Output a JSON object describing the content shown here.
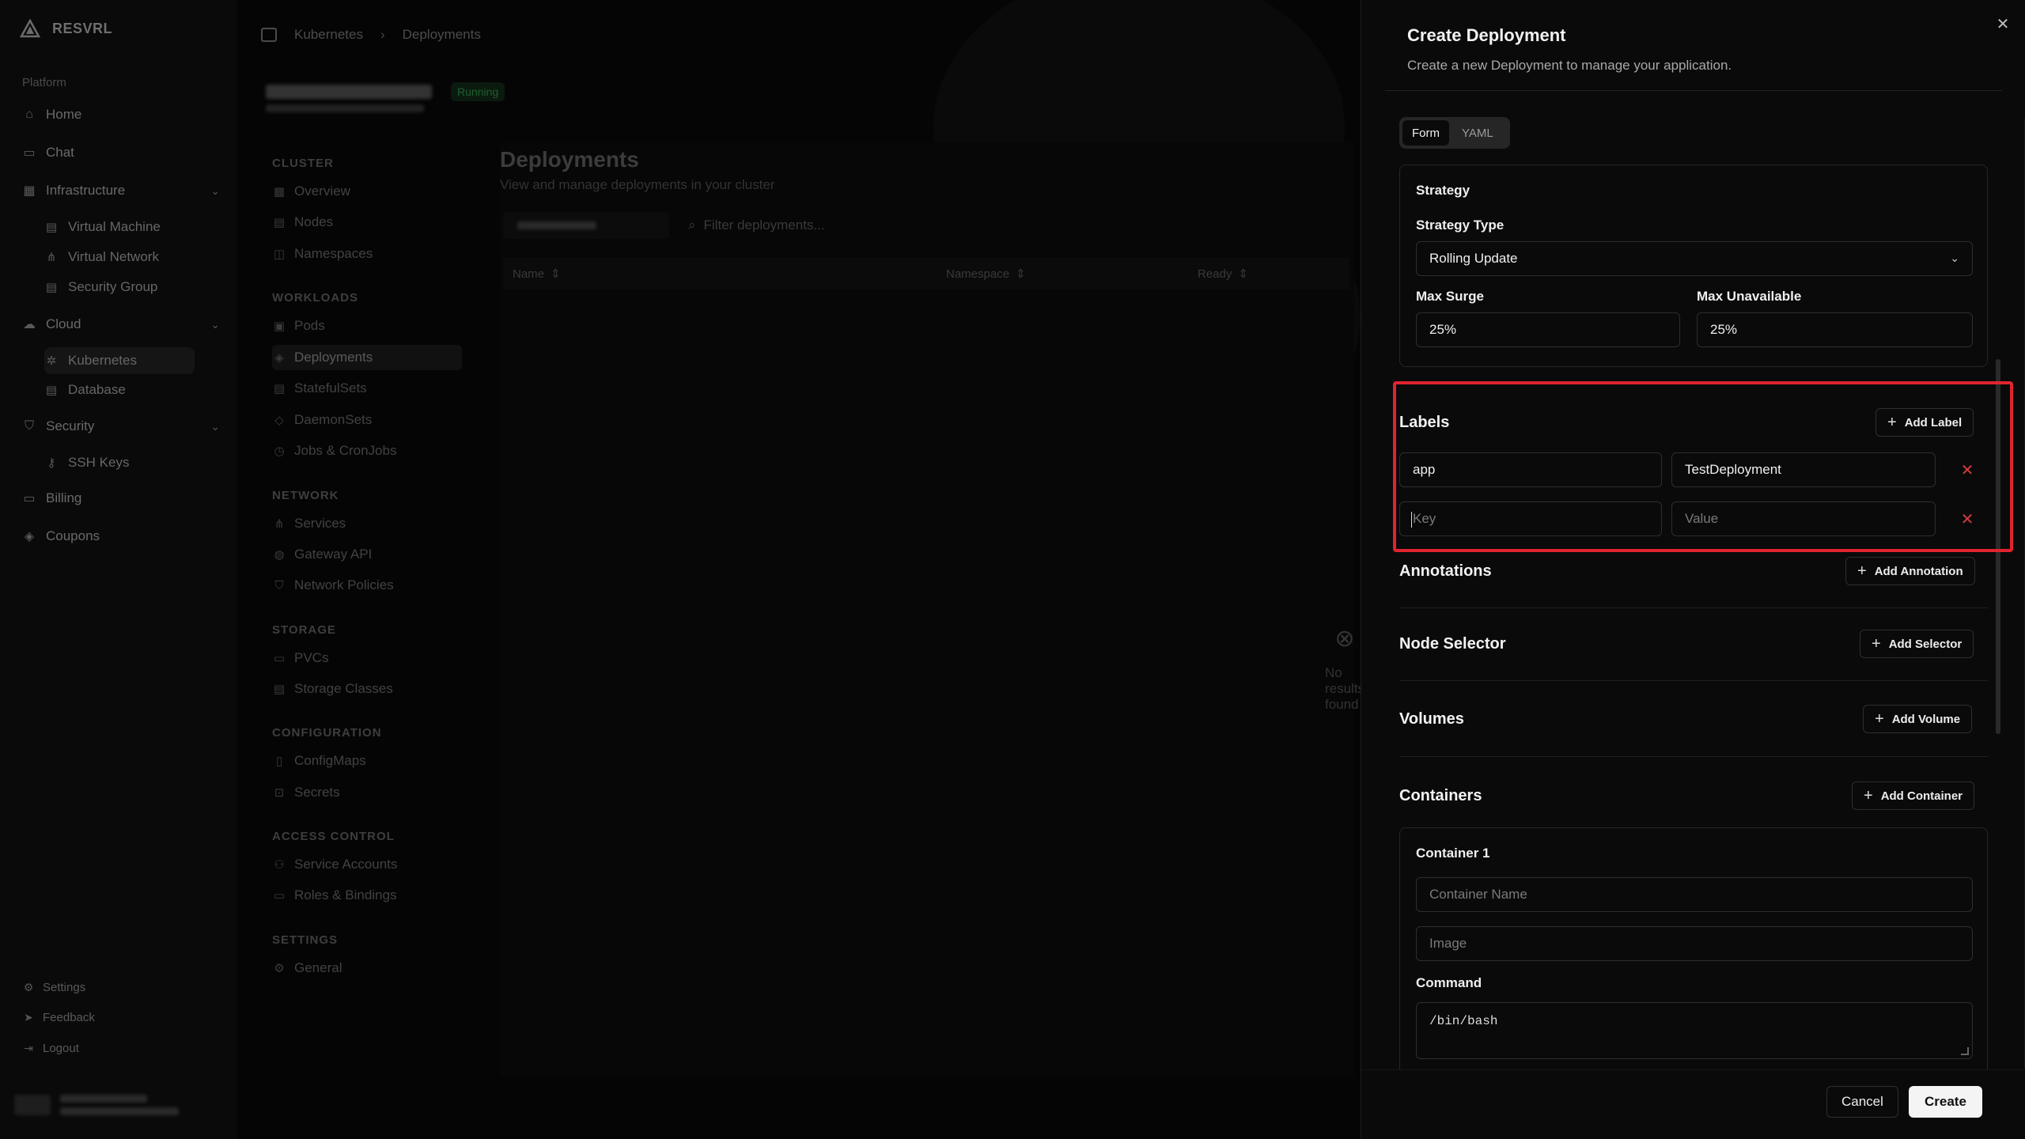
{
  "app": {
    "brand": "RESVRL"
  },
  "sidebar": {
    "group_label": "Platform",
    "items": [
      {
        "label": "Home",
        "icon": "home-icon"
      },
      {
        "label": "Chat",
        "icon": "chat-icon"
      },
      {
        "label": "Infrastructure",
        "icon": "grid-icon"
      },
      {
        "label": "Cloud",
        "icon": "cloud-icon"
      },
      {
        "label": "Security",
        "icon": "shield-icon"
      },
      {
        "label": "Billing",
        "icon": "billing-icon"
      },
      {
        "label": "Coupons",
        "icon": "tag-icon"
      }
    ],
    "infrastructure_children": [
      "Virtual Machine",
      "Virtual Network",
      "Security Group"
    ],
    "cloud_children": [
      "Kubernetes",
      "Database"
    ],
    "security_children": [
      "SSH Keys"
    ],
    "bottom": [
      "Settings",
      "Feedback",
      "Logout"
    ]
  },
  "breadcrumb": [
    "Kubernetes",
    "Deployments"
  ],
  "cluster": {
    "status": "Running"
  },
  "cluster_nav": {
    "sections": [
      {
        "title": "CLUSTER",
        "items": [
          "Overview",
          "Nodes",
          "Namespaces"
        ]
      },
      {
        "title": "WORKLOADS",
        "items": [
          "Pods",
          "Deployments",
          "StatefulSets",
          "DaemonSets",
          "Jobs & CronJobs"
        ]
      },
      {
        "title": "NETWORK",
        "items": [
          "Services",
          "Gateway API",
          "Network Policies"
        ]
      },
      {
        "title": "STORAGE",
        "items": [
          "PVCs",
          "Storage Classes"
        ]
      },
      {
        "title": "CONFIGURATION",
        "items": [
          "ConfigMaps",
          "Secrets"
        ]
      },
      {
        "title": "ACCESS CONTROL",
        "items": [
          "Service Accounts",
          "Roles & Bindings"
        ]
      },
      {
        "title": "SETTINGS",
        "items": [
          "General"
        ]
      }
    ]
  },
  "deployments": {
    "title": "Deployments",
    "subtitle": "View and manage deployments in your cluster",
    "filter_placeholder": "Filter deployments...",
    "columns": [
      "Name",
      "Namespace",
      "Ready"
    ],
    "empty": "No results found"
  },
  "sheet": {
    "title": "Create Deployment",
    "description": "Create a new Deployment to manage your application.",
    "modes": [
      "Form",
      "YAML"
    ],
    "strategy": {
      "title": "Strategy",
      "type_label": "Strategy Type",
      "type_value": "Rolling Update",
      "max_surge_label": "Max Surge",
      "max_surge_value": "25%",
      "max_unavailable_label": "Max Unavailable",
      "max_unavailable_value": "25%"
    },
    "labels": {
      "title": "Labels",
      "add_button": "Add Label",
      "rows": [
        {
          "key": "app",
          "value": "TestDeployment"
        },
        {
          "key": "",
          "value": ""
        }
      ],
      "key_placeholder": "Key",
      "value_placeholder": "Value"
    },
    "annotations": {
      "title": "Annotations",
      "add_button": "Add Annotation"
    },
    "node_selector": {
      "title": "Node Selector",
      "add_button": "Add Selector"
    },
    "volumes": {
      "title": "Volumes",
      "add_button": "Add Volume"
    },
    "containers": {
      "title": "Containers",
      "add_button": "Add Container",
      "container_title": "Container 1",
      "name_placeholder": "Container Name",
      "image_placeholder": "Image",
      "command_label": "Command",
      "command_value": "/bin/bash"
    },
    "footer": {
      "cancel": "Cancel",
      "create": "Create"
    }
  },
  "colors": {
    "highlight": "#e0242f",
    "remove": "#d03b3b"
  }
}
